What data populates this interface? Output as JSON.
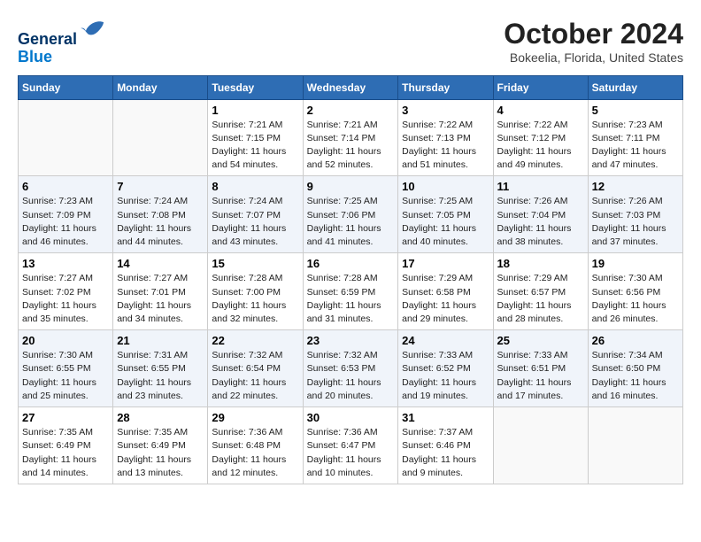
{
  "header": {
    "logo_line1": "General",
    "logo_line2": "Blue",
    "month_title": "October 2024",
    "location": "Bokeelia, Florida, United States"
  },
  "weekdays": [
    "Sunday",
    "Monday",
    "Tuesday",
    "Wednesday",
    "Thursday",
    "Friday",
    "Saturday"
  ],
  "weeks": [
    [
      {
        "day": "",
        "sunrise": "",
        "sunset": "",
        "daylight": ""
      },
      {
        "day": "",
        "sunrise": "",
        "sunset": "",
        "daylight": ""
      },
      {
        "day": "1",
        "sunrise": "Sunrise: 7:21 AM",
        "sunset": "Sunset: 7:15 PM",
        "daylight": "Daylight: 11 hours and 54 minutes."
      },
      {
        "day": "2",
        "sunrise": "Sunrise: 7:21 AM",
        "sunset": "Sunset: 7:14 PM",
        "daylight": "Daylight: 11 hours and 52 minutes."
      },
      {
        "day": "3",
        "sunrise": "Sunrise: 7:22 AM",
        "sunset": "Sunset: 7:13 PM",
        "daylight": "Daylight: 11 hours and 51 minutes."
      },
      {
        "day": "4",
        "sunrise": "Sunrise: 7:22 AM",
        "sunset": "Sunset: 7:12 PM",
        "daylight": "Daylight: 11 hours and 49 minutes."
      },
      {
        "day": "5",
        "sunrise": "Sunrise: 7:23 AM",
        "sunset": "Sunset: 7:11 PM",
        "daylight": "Daylight: 11 hours and 47 minutes."
      }
    ],
    [
      {
        "day": "6",
        "sunrise": "Sunrise: 7:23 AM",
        "sunset": "Sunset: 7:09 PM",
        "daylight": "Daylight: 11 hours and 46 minutes."
      },
      {
        "day": "7",
        "sunrise": "Sunrise: 7:24 AM",
        "sunset": "Sunset: 7:08 PM",
        "daylight": "Daylight: 11 hours and 44 minutes."
      },
      {
        "day": "8",
        "sunrise": "Sunrise: 7:24 AM",
        "sunset": "Sunset: 7:07 PM",
        "daylight": "Daylight: 11 hours and 43 minutes."
      },
      {
        "day": "9",
        "sunrise": "Sunrise: 7:25 AM",
        "sunset": "Sunset: 7:06 PM",
        "daylight": "Daylight: 11 hours and 41 minutes."
      },
      {
        "day": "10",
        "sunrise": "Sunrise: 7:25 AM",
        "sunset": "Sunset: 7:05 PM",
        "daylight": "Daylight: 11 hours and 40 minutes."
      },
      {
        "day": "11",
        "sunrise": "Sunrise: 7:26 AM",
        "sunset": "Sunset: 7:04 PM",
        "daylight": "Daylight: 11 hours and 38 minutes."
      },
      {
        "day": "12",
        "sunrise": "Sunrise: 7:26 AM",
        "sunset": "Sunset: 7:03 PM",
        "daylight": "Daylight: 11 hours and 37 minutes."
      }
    ],
    [
      {
        "day": "13",
        "sunrise": "Sunrise: 7:27 AM",
        "sunset": "Sunset: 7:02 PM",
        "daylight": "Daylight: 11 hours and 35 minutes."
      },
      {
        "day": "14",
        "sunrise": "Sunrise: 7:27 AM",
        "sunset": "Sunset: 7:01 PM",
        "daylight": "Daylight: 11 hours and 34 minutes."
      },
      {
        "day": "15",
        "sunrise": "Sunrise: 7:28 AM",
        "sunset": "Sunset: 7:00 PM",
        "daylight": "Daylight: 11 hours and 32 minutes."
      },
      {
        "day": "16",
        "sunrise": "Sunrise: 7:28 AM",
        "sunset": "Sunset: 6:59 PM",
        "daylight": "Daylight: 11 hours and 31 minutes."
      },
      {
        "day": "17",
        "sunrise": "Sunrise: 7:29 AM",
        "sunset": "Sunset: 6:58 PM",
        "daylight": "Daylight: 11 hours and 29 minutes."
      },
      {
        "day": "18",
        "sunrise": "Sunrise: 7:29 AM",
        "sunset": "Sunset: 6:57 PM",
        "daylight": "Daylight: 11 hours and 28 minutes."
      },
      {
        "day": "19",
        "sunrise": "Sunrise: 7:30 AM",
        "sunset": "Sunset: 6:56 PM",
        "daylight": "Daylight: 11 hours and 26 minutes."
      }
    ],
    [
      {
        "day": "20",
        "sunrise": "Sunrise: 7:30 AM",
        "sunset": "Sunset: 6:55 PM",
        "daylight": "Daylight: 11 hours and 25 minutes."
      },
      {
        "day": "21",
        "sunrise": "Sunrise: 7:31 AM",
        "sunset": "Sunset: 6:55 PM",
        "daylight": "Daylight: 11 hours and 23 minutes."
      },
      {
        "day": "22",
        "sunrise": "Sunrise: 7:32 AM",
        "sunset": "Sunset: 6:54 PM",
        "daylight": "Daylight: 11 hours and 22 minutes."
      },
      {
        "day": "23",
        "sunrise": "Sunrise: 7:32 AM",
        "sunset": "Sunset: 6:53 PM",
        "daylight": "Daylight: 11 hours and 20 minutes."
      },
      {
        "day": "24",
        "sunrise": "Sunrise: 7:33 AM",
        "sunset": "Sunset: 6:52 PM",
        "daylight": "Daylight: 11 hours and 19 minutes."
      },
      {
        "day": "25",
        "sunrise": "Sunrise: 7:33 AM",
        "sunset": "Sunset: 6:51 PM",
        "daylight": "Daylight: 11 hours and 17 minutes."
      },
      {
        "day": "26",
        "sunrise": "Sunrise: 7:34 AM",
        "sunset": "Sunset: 6:50 PM",
        "daylight": "Daylight: 11 hours and 16 minutes."
      }
    ],
    [
      {
        "day": "27",
        "sunrise": "Sunrise: 7:35 AM",
        "sunset": "Sunset: 6:49 PM",
        "daylight": "Daylight: 11 hours and 14 minutes."
      },
      {
        "day": "28",
        "sunrise": "Sunrise: 7:35 AM",
        "sunset": "Sunset: 6:49 PM",
        "daylight": "Daylight: 11 hours and 13 minutes."
      },
      {
        "day": "29",
        "sunrise": "Sunrise: 7:36 AM",
        "sunset": "Sunset: 6:48 PM",
        "daylight": "Daylight: 11 hours and 12 minutes."
      },
      {
        "day": "30",
        "sunrise": "Sunrise: 7:36 AM",
        "sunset": "Sunset: 6:47 PM",
        "daylight": "Daylight: 11 hours and 10 minutes."
      },
      {
        "day": "31",
        "sunrise": "Sunrise: 7:37 AM",
        "sunset": "Sunset: 6:46 PM",
        "daylight": "Daylight: 11 hours and 9 minutes."
      },
      {
        "day": "",
        "sunrise": "",
        "sunset": "",
        "daylight": ""
      },
      {
        "day": "",
        "sunrise": "",
        "sunset": "",
        "daylight": ""
      }
    ]
  ]
}
